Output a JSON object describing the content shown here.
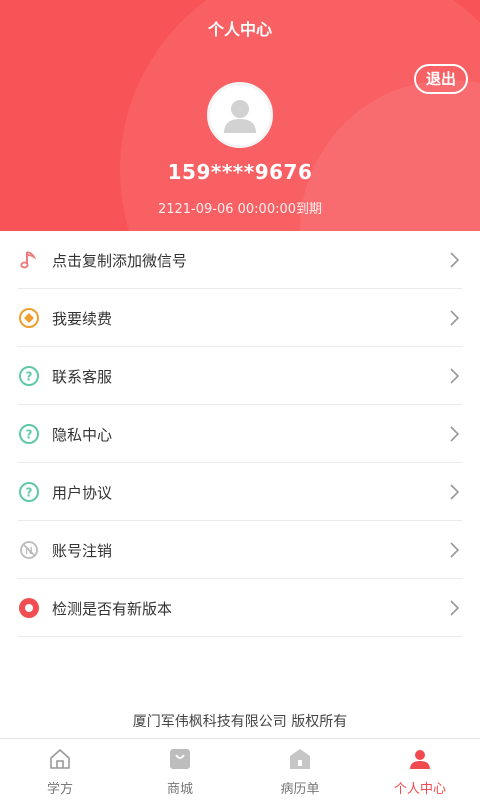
{
  "header": {
    "title": "个人中心",
    "logout_label": "退出",
    "phone": "159****9676",
    "expire_text": "2121-09-06 00:00:00到期"
  },
  "menu": {
    "items": [
      {
        "label": "点击复制添加微信号",
        "icon": "music-note-icon"
      },
      {
        "label": "我要续费",
        "icon": "coin-icon"
      },
      {
        "label": "联系客服",
        "icon": "question-circle-icon"
      },
      {
        "label": "隐私中心",
        "icon": "question-circle-icon"
      },
      {
        "label": "用户协议",
        "icon": "question-circle-icon"
      },
      {
        "label": "账号注销",
        "icon": "block-circle-icon"
      },
      {
        "label": "检测是否有新版本",
        "icon": "record-circle-icon"
      }
    ]
  },
  "footer": {
    "copyright": "厦门军伟枫科技有限公司 版权所有"
  },
  "tabbar": {
    "tabs": [
      {
        "label": "学方",
        "icon": "home-icon"
      },
      {
        "label": "商城",
        "icon": "shop-bag-icon"
      },
      {
        "label": "病历单",
        "icon": "record-book-icon"
      },
      {
        "label": "个人中心",
        "icon": "user-icon"
      }
    ],
    "active_index": 3
  },
  "colors": {
    "brand": "#f85458",
    "active_tab": "#f04a50",
    "icon_teal": "#5ec8a8",
    "icon_orange": "#f0a030"
  }
}
